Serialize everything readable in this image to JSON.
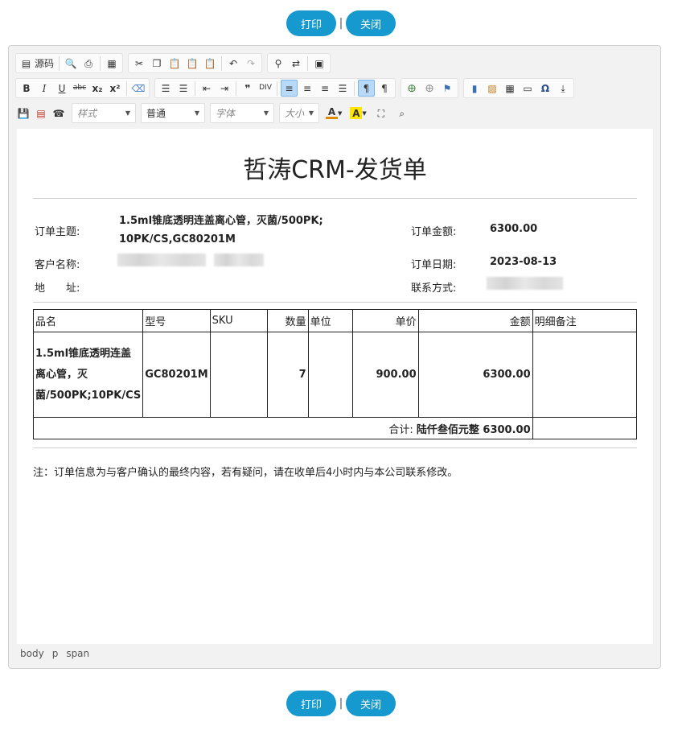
{
  "actions": {
    "print_label": "打印",
    "close_label": "关闭",
    "separator": "|"
  },
  "toolbar": {
    "source_label": "源码",
    "style_placeholder": "样式",
    "format_value": "普通",
    "font_placeholder": "字体",
    "size_placeholder": "大小",
    "bold": "B",
    "italic": "I",
    "underline": "U",
    "strike": "abc",
    "subscript": "x₂",
    "superscript": "x²"
  },
  "document": {
    "title": "哲涛CRM-发货单",
    "order_subject_label": "订单主题:",
    "order_subject_line1": "1.5ml锥底透明连盖离心管，灭菌/500PK;",
    "order_subject_line2": "10PK/CS,GC80201M",
    "order_amount_label": "订单金额:",
    "order_amount_value": "6300.00",
    "customer_label": "客户名称:",
    "order_date_label": "订单日期:",
    "order_date_value": "2023-08-13",
    "address_label": "地　　址:",
    "contact_label": "联系方式:",
    "table": {
      "headers": [
        "品名",
        "型号",
        "SKU",
        "数量",
        "单位",
        "单价",
        "金额",
        "明细备注"
      ],
      "rows": [
        {
          "name": "1.5ml锥底透明连盖离心管，灭菌/500PK;10PK/CS",
          "model": "GC80201M",
          "sku": "",
          "qty": "7",
          "unit": "",
          "price": "900.00",
          "amount": "6300.00",
          "remark": ""
        }
      ],
      "total_label": "合计:",
      "total_value": "陆仟叁佰元整 6300.00"
    },
    "note": "注：订单信息为与客户确认的最终内容，若有疑问，请在收单后4小时内与本公司联系修改。"
  },
  "statusbar": {
    "path": [
      "body",
      "p",
      "span"
    ]
  }
}
